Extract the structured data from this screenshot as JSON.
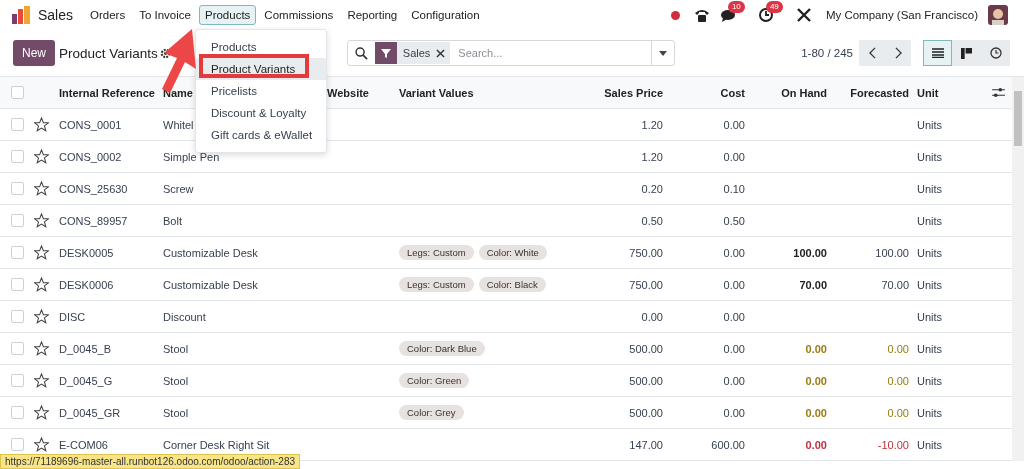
{
  "app": {
    "name": "Sales"
  },
  "menu": [
    {
      "label": "Orders",
      "selected": false
    },
    {
      "label": "To Invoice",
      "selected": false
    },
    {
      "label": "Products",
      "selected": true
    },
    {
      "label": "Commissions",
      "selected": false
    },
    {
      "label": "Reporting",
      "selected": false
    },
    {
      "label": "Configuration",
      "selected": false
    }
  ],
  "systray": {
    "messages_badge": "10",
    "activities_badge": "49",
    "company": "My Company (San Francisco)"
  },
  "control": {
    "new_button": "New",
    "title": "Product Variants",
    "facet": "Sales",
    "search_placeholder": "Search...",
    "pager": "1-80 / 245"
  },
  "views": [
    {
      "kind": "list",
      "selected": true
    },
    {
      "kind": "kanban",
      "selected": false
    },
    {
      "kind": "activity",
      "selected": false
    }
  ],
  "dropdown": [
    {
      "label": "Products",
      "selected": false
    },
    {
      "label": "Product Variants",
      "selected": true
    },
    {
      "label": "Pricelists",
      "selected": false
    },
    {
      "label": "Discount & Loyalty",
      "selected": false
    },
    {
      "label": "Gift cards & eWallet",
      "selected": false
    }
  ],
  "table": {
    "all_checked": false,
    "columns": [
      "Internal Reference",
      "Name",
      "Website",
      "Variant Values",
      "Sales Price",
      "Cost",
      "On Hand",
      "Forecasted",
      "Unit"
    ],
    "rows": [
      {
        "checked": false,
        "ref": "CONS_0001",
        "name": "Whitel",
        "variants": [],
        "price": "1.20",
        "cost": "0.00",
        "unit": "Units"
      },
      {
        "checked": false,
        "ref": "CONS_0002",
        "name": "Simple Pen",
        "variants": [],
        "price": "1.20",
        "cost": "0.00",
        "unit": "Units"
      },
      {
        "checked": false,
        "ref": "CONS_25630",
        "name": "Screw",
        "variants": [],
        "price": "0.20",
        "cost": "0.10",
        "unit": "Units"
      },
      {
        "checked": false,
        "ref": "CONS_89957",
        "name": "Bolt",
        "variants": [],
        "price": "0.50",
        "cost": "0.50",
        "unit": "Units"
      },
      {
        "checked": false,
        "ref": "DESK0005",
        "name": "Customizable Desk",
        "variants": [
          "Legs: Custom",
          "Color: White"
        ],
        "price": "750.00",
        "cost": "0.00",
        "on_hand": "100.00",
        "forecasted": "100.00",
        "unit": "Units",
        "kind": "positive"
      },
      {
        "checked": false,
        "ref": "DESK0006",
        "name": "Customizable Desk",
        "variants": [
          "Legs: Custom",
          "Color: Black"
        ],
        "price": "750.00",
        "cost": "0.00",
        "on_hand": "70.00",
        "forecasted": "70.00",
        "unit": "Units",
        "kind": "positive"
      },
      {
        "checked": false,
        "ref": "DISC",
        "name": "Discount",
        "variants": [],
        "price": "0.00",
        "cost": "0.00",
        "unit": "Units"
      },
      {
        "checked": false,
        "ref": "D_0045_B",
        "name": "Stool",
        "variants": [
          "Color: Dark Blue"
        ],
        "price": "500.00",
        "cost": "0.00",
        "on_hand": "0.00",
        "forecasted": "0.00",
        "unit": "Units",
        "kind": "zero"
      },
      {
        "checked": false,
        "ref": "D_0045_G",
        "name": "Stool",
        "variants": [
          "Color: Green"
        ],
        "price": "500.00",
        "cost": "0.00",
        "on_hand": "0.00",
        "forecasted": "0.00",
        "unit": "Units",
        "kind": "zero"
      },
      {
        "checked": false,
        "ref": "D_0045_GR",
        "name": "Stool",
        "variants": [
          "Color: Grey"
        ],
        "price": "500.00",
        "cost": "0.00",
        "on_hand": "0.00",
        "forecasted": "0.00",
        "unit": "Units",
        "kind": "zero"
      },
      {
        "checked": false,
        "ref": "E-COM06",
        "name": "Corner Desk Right Sit",
        "variants": [],
        "price": "147.00",
        "cost": "600.00",
        "on_hand": "0.00",
        "forecasted": "-10.00",
        "unit": "Units",
        "kind": "negative"
      }
    ]
  },
  "status_url": "https://71189696-master-all.runbot126.odoo.com/odoo/action-283"
}
